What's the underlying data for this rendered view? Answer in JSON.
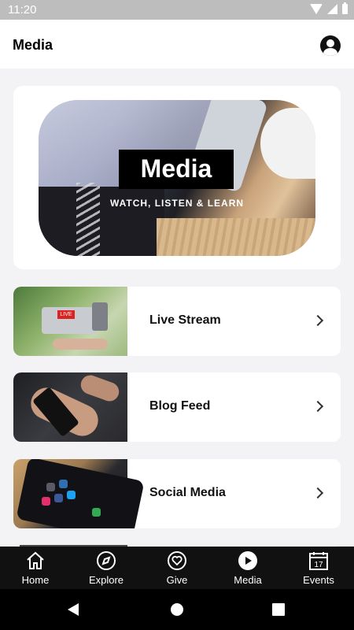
{
  "status_bar": {
    "time": "11:20"
  },
  "header": {
    "title": "Media",
    "profile_icon": "user-circle-icon"
  },
  "hero": {
    "title": "Media",
    "tagline": "WATCH, LISTEN & LEARN"
  },
  "rows": [
    {
      "label": "Live Stream",
      "thumb": "live-stream-thumbnail"
    },
    {
      "label": "Blog Feed",
      "thumb": "blog-feed-thumbnail"
    },
    {
      "label": "Social Media",
      "thumb": "social-media-thumbnail"
    }
  ],
  "bottom_nav": [
    {
      "label": "Home",
      "icon": "home-icon"
    },
    {
      "label": "Explore",
      "icon": "compass-icon"
    },
    {
      "label": "Give",
      "icon": "heart-icon"
    },
    {
      "label": "Media",
      "icon": "play-icon",
      "active": true
    },
    {
      "label": "Events",
      "icon": "calendar-icon",
      "day": "17"
    }
  ],
  "colors": {
    "nav_bg": "#111111",
    "page_bg": "#f3f3f6",
    "status_bg": "#bdbdbd",
    "live_badge": "#dd2222"
  }
}
